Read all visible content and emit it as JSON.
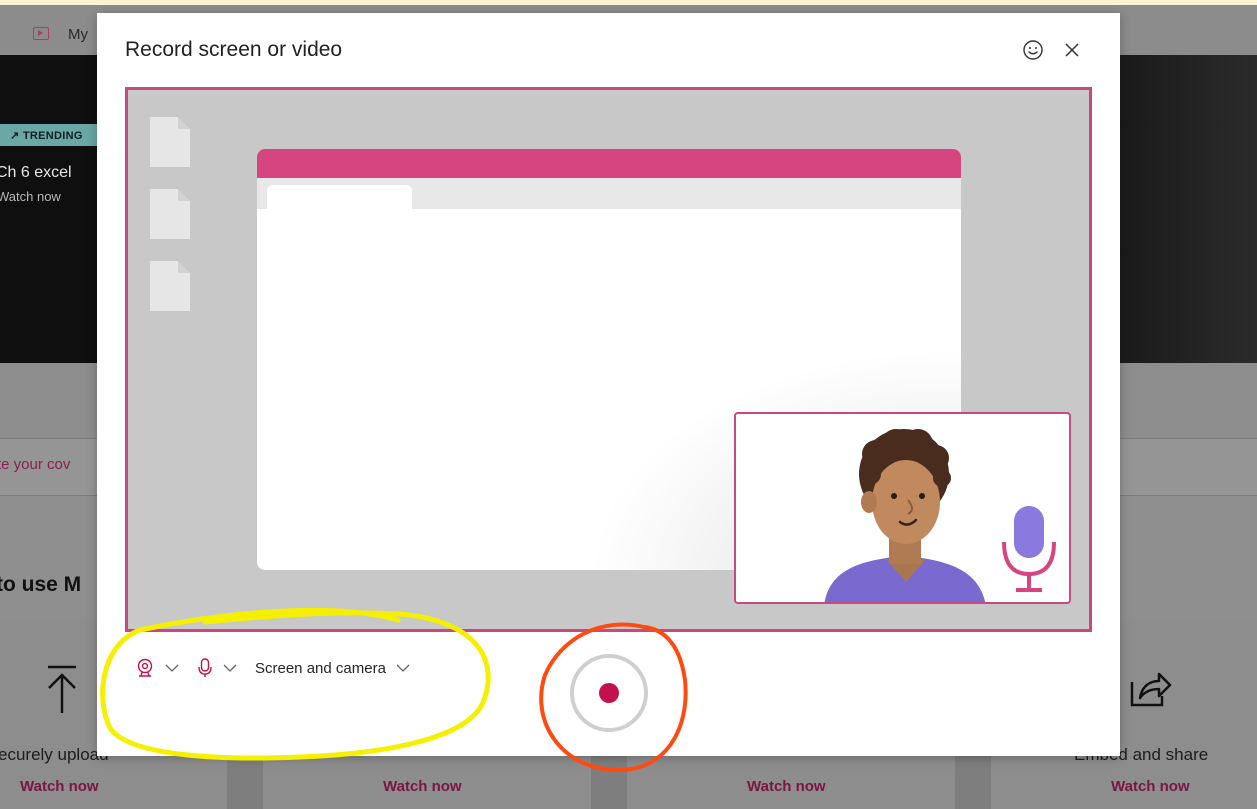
{
  "background": {
    "nav": {
      "label": "My"
    },
    "hero": {
      "badge": "TRENDING",
      "title": "Ch 6 excel",
      "subtitle": "Watch now"
    },
    "cover_link": "te your cov",
    "section_heading": "to use M",
    "tiles": [
      {
        "label": "ecurely upload",
        "watch": "Watch now"
      },
      {
        "label": "",
        "watch": "Watch now"
      },
      {
        "label": "",
        "watch": "Watch now"
      },
      {
        "label": "Embed and share",
        "watch": "Watch now"
      }
    ]
  },
  "dialog": {
    "title": "Record screen or video",
    "icons": {
      "feedback": "smiley-icon",
      "close": "close-icon"
    },
    "controls": {
      "camera_icon": "webcam-icon",
      "mic_icon": "microphone-icon",
      "mode_label": "Screen and camera"
    },
    "record_icon": "record-icon"
  },
  "colors": {
    "accent": "#c8497f",
    "window_bar": "#d64580",
    "record": "#c2114d",
    "highlight_yellow": "#f5f000",
    "highlight_orange": "#ff4a12"
  }
}
